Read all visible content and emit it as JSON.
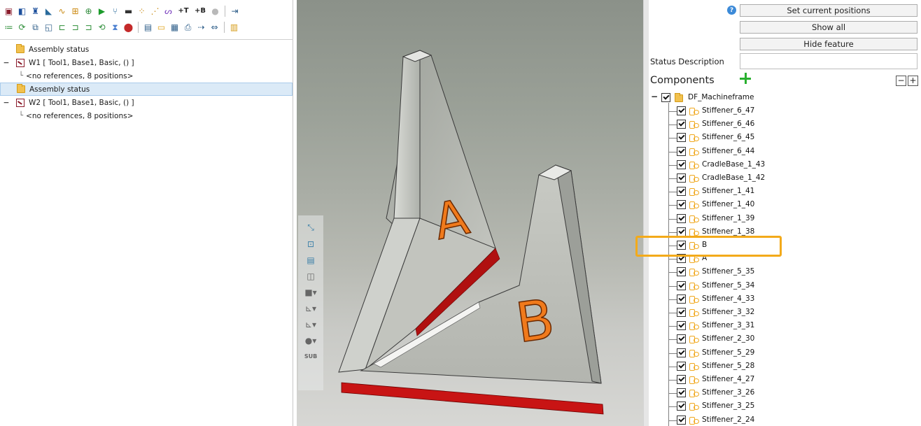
{
  "toolbar": {
    "row1": [
      "assembly-icon",
      "open-project-icon",
      "robot-icon",
      "measure-angle-icon",
      "path-icon",
      "grid-icon",
      "target-icon",
      "play-icon",
      "branch-icon",
      "folder-icon",
      "points-icon",
      "scatter-icon",
      "curve-icon",
      "add-t-icon",
      "add-b-icon",
      "record-icon",
      "export-icon"
    ],
    "row2": [
      "list-icon",
      "loop-icon",
      "copy-icon",
      "frame-icon",
      "stack-icon",
      "step-icon",
      "join-icon",
      "refresh-icon",
      "hourglass-icon",
      "stop-icon",
      "document-icon",
      "folder-open-icon",
      "page-icon",
      "printer-icon",
      "link-right-icon",
      "link-icon",
      "bar-chart-icon"
    ]
  },
  "tree": {
    "rows": [
      {
        "label": "Assembly status",
        "kind": "status"
      },
      {
        "label": "W1  [ Tool1, Base1, Basic, () ]",
        "kind": "instruction"
      },
      {
        "label": "<no references, 8 positions>",
        "kind": "ref"
      },
      {
        "label": "Assembly status",
        "kind": "status",
        "selected": true
      },
      {
        "label": "W2  [ Tool1, Base1, Basic, () ]",
        "kind": "instruction"
      },
      {
        "label": "<no references, 8 positions>",
        "kind": "ref"
      }
    ]
  },
  "viewport": {
    "tools": [
      "fit-all-icon",
      "fit-selection-icon",
      "view-layer-icon",
      "cube-outline-icon",
      "solid-cube-icon",
      "axes-icon",
      "axes-alt-icon",
      "sphere-icon"
    ],
    "sub_label": "SUB",
    "part_a_label": "A",
    "part_b_label": "B",
    "colors": {
      "part": "#b9bbb5",
      "edge": "#cc1414",
      "letter": "#f07a1c"
    }
  },
  "right": {
    "buttons": {
      "set_positions": "Set current positions",
      "show_all": "Show all",
      "hide_feature": "Hide feature"
    },
    "status_description_label": "Status Description",
    "status_description_value": "",
    "components_label": "Components",
    "collapse_label": "−",
    "expand_label": "+",
    "root": "DF_Machineframe",
    "components": [
      "Stiffener_6_47",
      "Stiffener_6_46",
      "Stiffener_6_45",
      "Stiffener_6_44",
      "CradleBase_1_43",
      "CradleBase_1_42",
      "Stiffener_1_41",
      "Stiffener_1_40",
      "Stiffener_1_39",
      "Stiffener_1_38",
      "B",
      "A",
      "Stiffener_5_35",
      "Stiffener_5_34",
      "Stiffener_4_33",
      "Stiffener_3_32",
      "Stiffener_3_31",
      "Stiffener_2_30",
      "Stiffener_5_29",
      "Stiffener_5_28",
      "Stiffener_4_27",
      "Stiffener_3_26",
      "Stiffener_3_25",
      "Stiffener_2_24"
    ],
    "highlight": {
      "item": "B",
      "color": "#f3aa1a"
    }
  }
}
